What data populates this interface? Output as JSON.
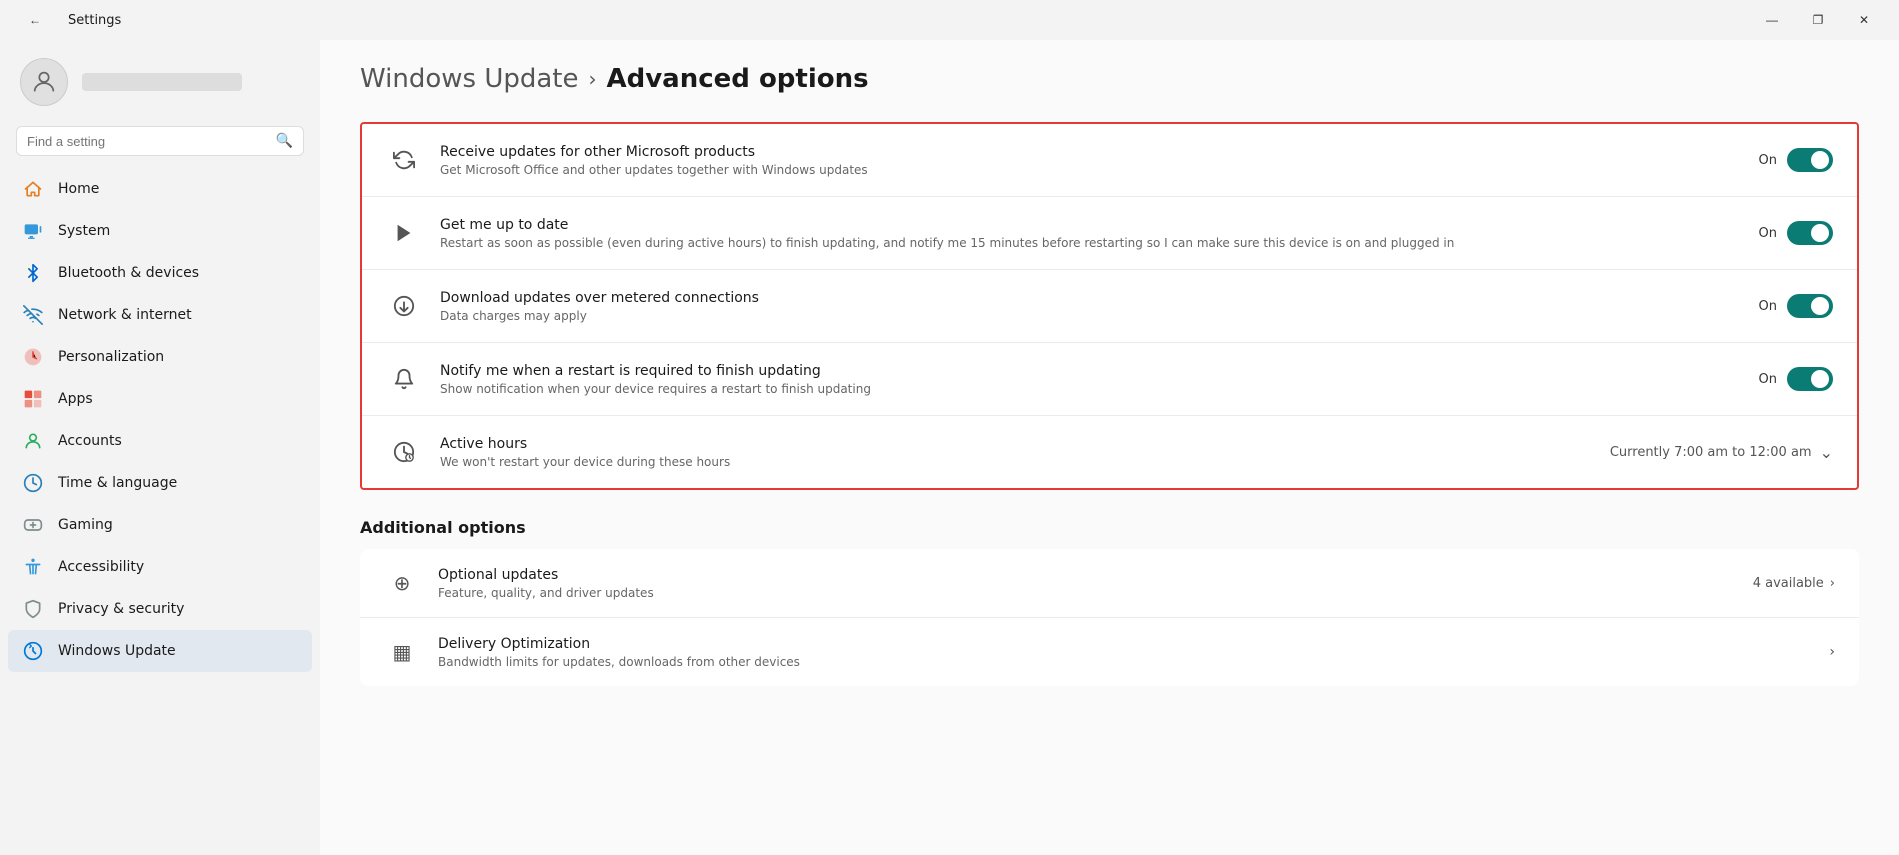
{
  "titlebar": {
    "title": "Settings",
    "back_label": "←",
    "minimize": "—",
    "restore": "❐",
    "close": "✕"
  },
  "sidebar": {
    "search_placeholder": "Find a setting",
    "user_name": "",
    "nav_items": [
      {
        "id": "home",
        "label": "Home",
        "icon": "home"
      },
      {
        "id": "system",
        "label": "System",
        "icon": "system"
      },
      {
        "id": "bluetooth",
        "label": "Bluetooth & devices",
        "icon": "bluetooth"
      },
      {
        "id": "network",
        "label": "Network & internet",
        "icon": "network"
      },
      {
        "id": "personalization",
        "label": "Personalization",
        "icon": "personalization"
      },
      {
        "id": "apps",
        "label": "Apps",
        "icon": "apps"
      },
      {
        "id": "accounts",
        "label": "Accounts",
        "icon": "accounts"
      },
      {
        "id": "time",
        "label": "Time & language",
        "icon": "time"
      },
      {
        "id": "gaming",
        "label": "Gaming",
        "icon": "gaming"
      },
      {
        "id": "accessibility",
        "label": "Accessibility",
        "icon": "accessibility"
      },
      {
        "id": "privacy",
        "label": "Privacy & security",
        "icon": "privacy"
      },
      {
        "id": "update",
        "label": "Windows Update",
        "icon": "update",
        "active": true
      }
    ]
  },
  "main": {
    "breadcrumb_parent": "Windows Update",
    "breadcrumb_chevron": "›",
    "breadcrumb_current": "Advanced options",
    "highlighted_settings": [
      {
        "id": "receive-updates",
        "icon": "↻",
        "title": "Receive updates for other Microsoft products",
        "desc": "Get Microsoft Office and other updates together with Windows updates",
        "control_type": "toggle",
        "on_label": "On",
        "enabled": true
      },
      {
        "id": "get-me-up-to-date",
        "icon": "▷",
        "title": "Get me up to date",
        "desc": "Restart as soon as possible (even during active hours) to finish updating, and notify me 15 minutes before restarting so I can make sure this device is on and plugged in",
        "control_type": "toggle",
        "on_label": "On",
        "enabled": true
      },
      {
        "id": "download-metered",
        "icon": "◎",
        "title": "Download updates over metered connections",
        "desc": "Data charges may apply",
        "control_type": "toggle",
        "on_label": "On",
        "enabled": true
      },
      {
        "id": "notify-restart",
        "icon": "🔔",
        "title": "Notify me when a restart is required to finish updating",
        "desc": "Show notification when your device requires a restart to finish updating",
        "control_type": "toggle",
        "on_label": "On",
        "enabled": true
      },
      {
        "id": "active-hours",
        "icon": "⊙",
        "title": "Active hours",
        "desc": "We won't restart your device during these hours",
        "control_type": "dropdown",
        "dropdown_label": "Currently 7:00 am to 12:00 am"
      }
    ],
    "additional_section_title": "Additional options",
    "additional_options": [
      {
        "id": "optional-updates",
        "icon": "⊕",
        "title": "Optional updates",
        "desc": "Feature, quality, and driver updates",
        "badge": "4 available"
      },
      {
        "id": "delivery-optimization",
        "icon": "▦",
        "title": "Delivery Optimization",
        "desc": "Bandwidth limits for updates, downloads from other devices",
        "badge": ""
      }
    ]
  }
}
